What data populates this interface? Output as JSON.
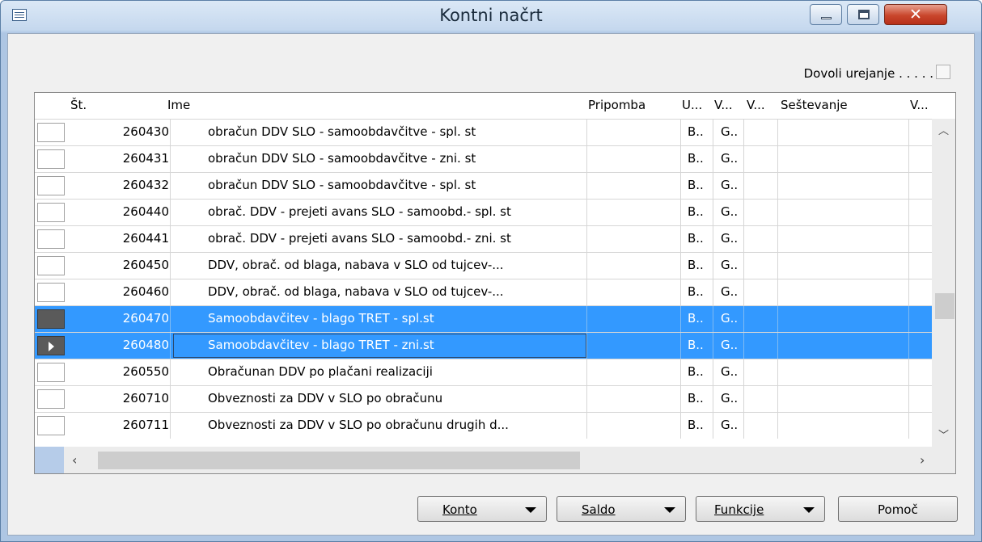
{
  "window": {
    "title": "Kontni načrt"
  },
  "allow_edit": {
    "label": "Dovoli urejanje . . . . ."
  },
  "grid": {
    "headers": [
      "Št.",
      "Ime",
      "Pripomba",
      "U...",
      "V...",
      "V...",
      "Seštevanje",
      "V..."
    ],
    "rows": [
      {
        "number": "260430",
        "name": "obračun DDV SLO - samoobdavčitve -  spl. st",
        "u": "B..",
        "v": "G..",
        "selected": false
      },
      {
        "number": "260431",
        "name": "obračun DDV SLO - samoobdavčitve -  zni. st",
        "u": "B..",
        "v": "G..",
        "selected": false
      },
      {
        "number": "260432",
        "name": "obračun DDV SLO - samoobdavčitve -  spl. st",
        "u": "B..",
        "v": "G..",
        "selected": false
      },
      {
        "number": "260440",
        "name": "obrač. DDV - prejeti avans SLO - samoobd.- spl. st",
        "u": "B..",
        "v": "G..",
        "selected": false
      },
      {
        "number": "260441",
        "name": "obrač. DDV - prejeti avans SLO - samoobd.- zni. st",
        "u": "B..",
        "v": "G..",
        "selected": false
      },
      {
        "number": "260450",
        "name": "DDV, obrač. od blaga, nabava v SLO od tujcev-...",
        "u": "B..",
        "v": "G..",
        "selected": false
      },
      {
        "number": "260460",
        "name": "DDV, obrač. od blaga, nabava v SLO od tujcev-...",
        "u": "B..",
        "v": "G..",
        "selected": false
      },
      {
        "number": "260470",
        "name": "Samoobdavčitev - blago TRET - spl.st",
        "u": "B..",
        "v": "G..",
        "selected": true
      },
      {
        "number": "260480",
        "name": "Samoobdavčitev - blago TRET - zni.st",
        "u": "B..",
        "v": "G..",
        "selected": true,
        "current": true
      },
      {
        "number": "260550",
        "name": "Obračunan DDV po plačani realizaciji",
        "u": "B..",
        "v": "G..",
        "selected": false
      },
      {
        "number": "260710",
        "name": "Obveznosti za DDV v SLO po obračunu",
        "u": "B..",
        "v": "G..",
        "selected": false
      },
      {
        "number": "260711",
        "name": "Obveznosti za DDV v SLO po obračunu drugih d...",
        "u": "B..",
        "v": "G..",
        "selected": false
      }
    ]
  },
  "buttons": {
    "konto": "Konto",
    "saldo": "Saldo",
    "funkcije": "Funkcije",
    "pomoc": "Pomoč"
  },
  "colors": {
    "selection": "#3399ff",
    "close_button": "#c9462c"
  },
  "icons": [
    "table-icon",
    "minimize-icon",
    "maximize-icon",
    "close-icon",
    "scroll-up-icon",
    "scroll-down-icon",
    "scroll-left-icon",
    "scroll-right-icon",
    "dropdown-caret-icon",
    "current-row-icon"
  ]
}
